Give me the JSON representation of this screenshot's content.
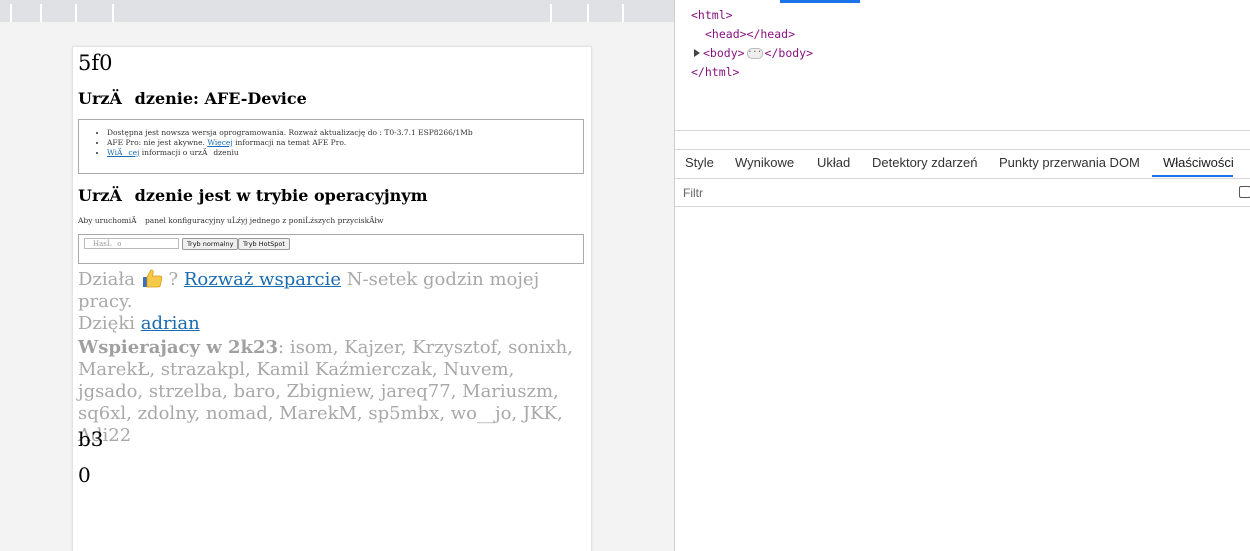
{
  "page": {
    "top_text": "5f0",
    "device_heading": "UrzÄdzenie: AFE-Device",
    "info_items": [
      {
        "text": "Dostępna jest nowsza wersja oprogramowania. Rozważ aktualizację do : T0-3.7.1 ESP8266/1Mb",
        "link": ""
      },
      {
        "text_before": "AFE Pro: nie jest akywne. ",
        "link": "Więcej",
        "text_after": " informacji na temat AFE Pro."
      },
      {
        "text_before": "",
        "link": "WiÄcej",
        "text_after": " informacji o urzÄdzeniu"
      }
    ],
    "mode_heading": "UrzÄdzenie jest w trybie operacyjnym",
    "mode_hint": "Aby uruchomiÄ panel konfiguracyjny uĹźyj jednego z poniĹźszych przyciskĂłw",
    "password_placeholder": "HasĹo",
    "btn_normal": "Tryb normalny",
    "btn_hotspot": "Tryb HotSpot",
    "support_pre": "Działa",
    "support_mid": " ? ",
    "support_link": "Rozważ wsparcie",
    "support_post": " N-setek godzin mojej pracy.",
    "thanks_pre": "Dzięki ",
    "thanks_link": "adrian",
    "supporters_label": "Wspierajacy w 2k23",
    "supporters_list": ": isom, Kajzer, Krzysztof, sonixh, MarekŁ, strazakpl, Kamil Kaźmierczak, Nuvem, jgsado, strzelba, baro, Zbigniew, jareq77, Mariuszm, sq6xl, zdolny, nomad, MarekM, sp5mbx, wo__jo, JKK, Adi22",
    "bottom_text_1": "b3",
    "bottom_text_2": "0"
  },
  "devtools": {
    "dom_lines": [
      "<html>",
      "<head></head>",
      "<body>",
      "</body>",
      "</html>"
    ],
    "tabs": [
      "Style",
      "Wynikowe",
      "Układ",
      "Detektory zdarzeń",
      "Punkty przerwania DOM",
      "Właściwości"
    ],
    "active_tab": "Właściwości",
    "filter_label": "Filtr"
  },
  "colors": {
    "accent": "#1a73e8",
    "link": "#1a6bb0",
    "muted_text": "#a8a8a8",
    "tag": "#881280"
  },
  "icons": [
    "thumbs-up-icon",
    "expand-arrow-icon",
    "ellipsis-icon",
    "checkbox-icon"
  ]
}
